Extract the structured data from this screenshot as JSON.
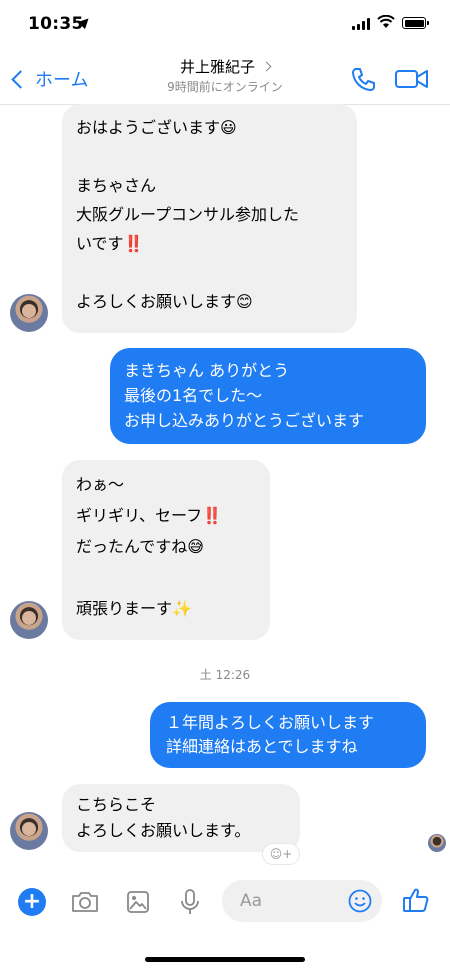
{
  "status": {
    "time": "10:35"
  },
  "nav": {
    "back_label": "ホーム",
    "contact_name": "井上雅紀子",
    "presence": "9時間前にオンライン"
  },
  "messages": [
    {
      "dir": "in",
      "text": "おはようございます😃\n\nまちゃさん\n大阪グループコンサル参加した\nいです‼️\n\nよろしくお願いします😊"
    },
    {
      "dir": "out",
      "text": "まきちゃん ありがとう\n最後の1名でした〜\nお申し込みありがとうございます"
    },
    {
      "dir": "in",
      "text": "わぁ〜\nギリギリ、セーフ‼️\nだったんですね😅\n\n頑張りまーす✨"
    },
    {
      "dir": "out",
      "text": "１年間よろしくお願いします\n詳細連絡はあとでしますね"
    },
    {
      "dir": "in",
      "text": "こちらこそ\nよろしくお願いします。"
    }
  ],
  "timestamp": "土 12:26",
  "composer": {
    "placeholder": "Aa"
  },
  "colors": {
    "accent": "#1f7cf3",
    "incoming_bubble": "#f0f0f0"
  }
}
